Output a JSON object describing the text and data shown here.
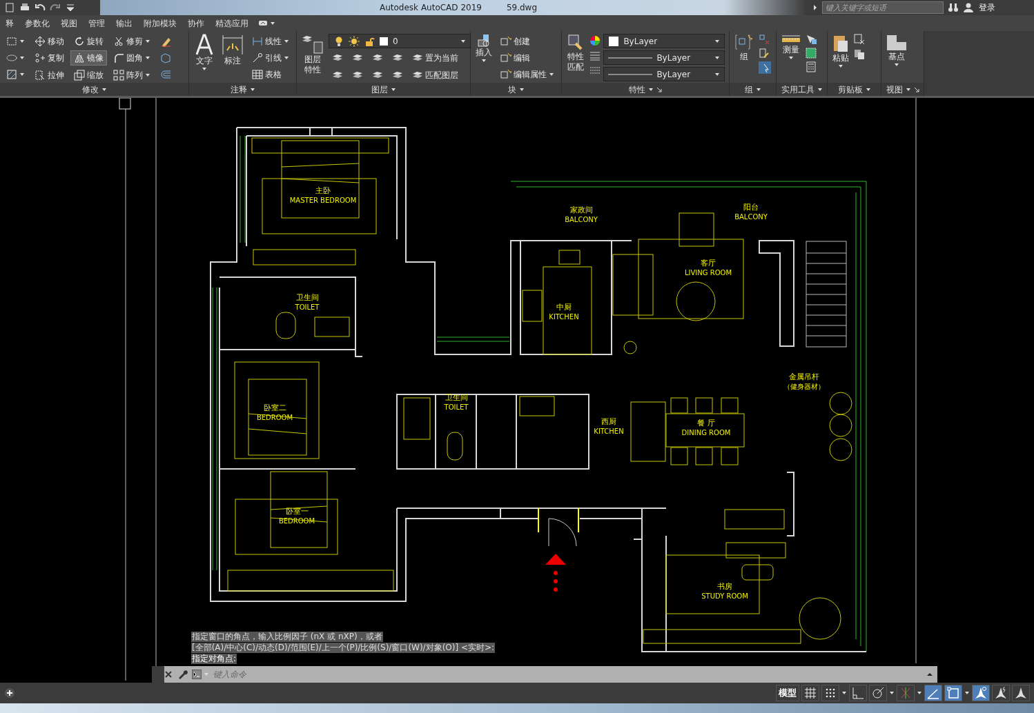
{
  "title_bar": {
    "app_name": "Autodesk AutoCAD 2019",
    "file_name": "59.dwg",
    "search": {
      "placeholder": "键入关键字或短语"
    },
    "login": "登录"
  },
  "menu_tabs": [
    {
      "label": "释"
    },
    {
      "label": "参数化"
    },
    {
      "label": "视图"
    },
    {
      "label": "管理"
    },
    {
      "label": "输出"
    },
    {
      "label": "附加模块"
    },
    {
      "label": "协作"
    },
    {
      "label": "精选应用"
    }
  ],
  "ribbon": {
    "modify": {
      "title": "修改",
      "tools": [
        {
          "label": "移动",
          "selected": false
        },
        {
          "label": "旋转",
          "selected": false
        },
        {
          "label": "修剪",
          "selected": false
        },
        {
          "label": "复制",
          "selected": false
        },
        {
          "label": "镜像",
          "selected": true
        },
        {
          "label": "圆角",
          "selected": false
        },
        {
          "label": "拉伸",
          "selected": false
        },
        {
          "label": "缩放",
          "selected": false
        },
        {
          "label": "阵列",
          "selected": false
        }
      ]
    },
    "annotation": {
      "title": "注释",
      "large_tools": [
        "文字",
        "标注"
      ],
      "tools": [
        "线性",
        "引线",
        "表格"
      ]
    },
    "layers": {
      "title": "图层",
      "layer_properties": "图层特性",
      "current_layer": "0",
      "tools": [
        "置为当前",
        "匹配图层"
      ]
    },
    "block": {
      "title": "块",
      "insert": "插入",
      "tools": [
        "创建",
        "编辑",
        "编辑属性"
      ]
    },
    "properties": {
      "title": "特性",
      "match": "特性匹配",
      "color_setting": "ByLayer",
      "linetype": "ByLayer",
      "lineweight": "ByLayer"
    },
    "groups": {
      "title": "组",
      "group": "组"
    },
    "utilities": {
      "title": "实用工具",
      "measure": "测量"
    },
    "clipboard": {
      "title": "剪贴板",
      "paste": "粘贴"
    },
    "view": {
      "title": "视图",
      "base_point": "基点"
    }
  },
  "drawing": {
    "room_labels": [
      {
        "name": "主卧",
        "name_en": "MASTER BEDROOM"
      },
      {
        "name": "家政间",
        "name_en": "BALCONY"
      },
      {
        "name": "阳台",
        "name_en": "BALCONY"
      },
      {
        "name": "客厅",
        "name_en": "LIVING ROOM"
      },
      {
        "name": "卫生间",
        "name_en": "TOILET"
      },
      {
        "name": "中厨",
        "name_en": "KITCHEN"
      },
      {
        "name": "金属吊杆",
        "name_en": "（健身器材）"
      },
      {
        "name": "卧室二",
        "name_en": "BEDROOM"
      },
      {
        "name": "卫生间",
        "name_en": "TOILET"
      },
      {
        "name": "西厨",
        "name_en": "KITCHEN"
      },
      {
        "name": "餐 厅",
        "name_en": "DINING ROOM"
      },
      {
        "name": "卧室一",
        "name_en": "BEDROOM"
      },
      {
        "name": "书房",
        "name_en": "STUDY ROOM"
      }
    ]
  },
  "command_line": {
    "history": [
      "指定窗口的角点，输入比例因子 (nX 或 nXP)，或者",
      "[全部(A)/中心(C)/动态(D)/范围(E)/上一个(P)/比例(S)/窗口(W)/对象(O)] <实时>:",
      "指定对角点:"
    ],
    "placeholder": "键入命令"
  },
  "status_bar": {
    "model": "模型",
    "toggles": [
      {
        "kind": "grid",
        "on": false
      },
      {
        "kind": "snap",
        "on": false
      },
      {
        "kind": "ortho",
        "on": false
      },
      {
        "kind": "polar",
        "on": false
      },
      {
        "kind": "tracking",
        "on": false
      },
      {
        "kind": "isodraft",
        "on": true
      },
      {
        "kind": "osnap",
        "on": true
      },
      {
        "kind": "visibility",
        "on": true
      },
      {
        "kind": "autoscale",
        "on": false
      },
      {
        "kind": "scale",
        "on": false
      }
    ]
  }
}
